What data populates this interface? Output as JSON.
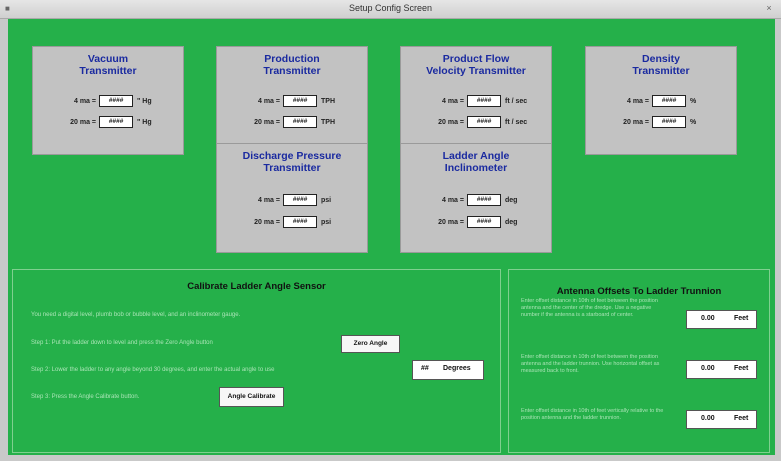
{
  "window": {
    "title": "Setup Config Screen",
    "close_label": "×",
    "app_icon": "■"
  },
  "transmitters": [
    {
      "title_line1": "Vacuum",
      "title_line2": "Transmitter",
      "rows": [
        {
          "label": "4 ma =",
          "value": "####",
          "unit": "\" Hg"
        },
        {
          "label": "20 ma =",
          "value": "####",
          "unit": "\" Hg"
        }
      ]
    },
    {
      "title_line1": "Production",
      "title_line2": "Transmitter",
      "rows": [
        {
          "label": "4 ma =",
          "value": "####",
          "unit": "TPH"
        },
        {
          "label": "20 ma =",
          "value": "####",
          "unit": "TPH"
        }
      ]
    },
    {
      "title_line1": "Product Flow",
      "title_line2": "Velocity Transmitter",
      "rows": [
        {
          "label": "4 ma =",
          "value": "####",
          "unit": "ft / sec"
        },
        {
          "label": "20 ma =",
          "value": "####",
          "unit": "ft / sec"
        }
      ]
    },
    {
      "title_line1": "Density",
      "title_line2": "Transmitter",
      "rows": [
        {
          "label": "4 ma =",
          "value": "####",
          "unit": "%"
        },
        {
          "label": "20 ma =",
          "value": "####",
          "unit": "%"
        }
      ]
    },
    {
      "title_line1": "Discharge Pressure",
      "title_line2": "Transmitter",
      "rows": [
        {
          "label": "4 ma =",
          "value": "####",
          "unit": "psi"
        },
        {
          "label": "20 ma =",
          "value": "####",
          "unit": "psi"
        }
      ]
    },
    {
      "title_line1": "Ladder Angle",
      "title_line2": "Inclinometer",
      "rows": [
        {
          "label": "4 ma =",
          "value": "####",
          "unit": "deg"
        },
        {
          "label": "20 ma =",
          "value": "####",
          "unit": "deg"
        }
      ]
    }
  ],
  "calibrate": {
    "title": "Calibrate Ladder Angle Sensor",
    "note": "You need a digital level, plumb bob or bubble level, and an inclinometer gauge.",
    "step1": "Step 1: Put the ladder down to level and press the Zero Angle button",
    "zero_button": "Zero Angle",
    "step2": "Step 2: Lower the ladder to any angle beyond 30 degrees, and enter the actual angle to use",
    "degrees_value": "##",
    "degrees_label": "Degrees",
    "step3": "Step 3: Press the Angle Calibrate button.",
    "calibrate_button": "Angle Calibrate"
  },
  "antenna": {
    "title": "Antenna Offsets To Ladder Trunnion",
    "items": [
      {
        "text": "Enter offset distance in 10th of feet between the position antenna and the center of the dredge. Use a negative number if the antenna is a starboard of center.",
        "value": "0.00",
        "unit": "Feet"
      },
      {
        "text": "Enter offset distance in 10th of feet between the position antenna and the ladder trunnion. Use horizontal offset as measured back to front.",
        "value": "0.00",
        "unit": "Feet"
      },
      {
        "text": "Enter offset distance in 10th of feet vertically relative to the position antenna and the ladder trunnion.",
        "value": "0.00",
        "unit": "Feet"
      }
    ]
  }
}
